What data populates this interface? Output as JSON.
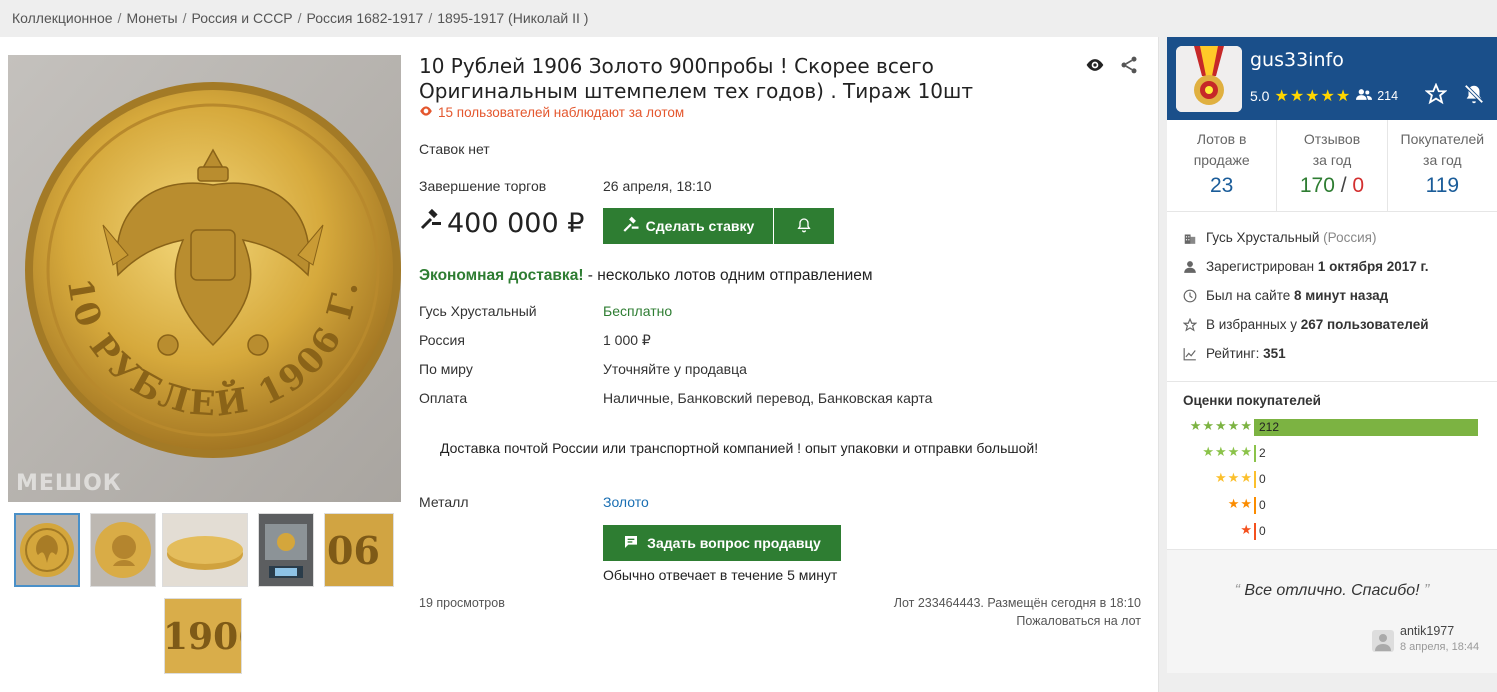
{
  "breadcrumb": [
    "Коллекционное",
    "Монеты",
    "Россия и СССР",
    "Россия 1682-1917",
    "1895-1917 (Николай II )"
  ],
  "lot": {
    "title": "10 Рублей 1906 Золото 900пробы ! Скорее всего Оригинальным штемпелем тех годов) . Тираж 10шт",
    "watchers": "15 пользователей наблюдают за лотом",
    "bids_label": "Ставок нет",
    "end_label": "Завершение торгов",
    "end_value": "26 апреля, 18:10",
    "price": "400 000 ₽",
    "bid_button": "Сделать ставку",
    "eco_bold": "Экономная доставка!",
    "eco_rest": " - несколько лотов одним отправлением",
    "delivery": [
      {
        "label": "Гусь Хрустальный",
        "value": "Бесплатно",
        "green": true
      },
      {
        "label": "Россия",
        "value": "1 000 ₽"
      },
      {
        "label": "По миру",
        "value": "Уточняйте у продавца"
      },
      {
        "label": "Оплата",
        "value": "Наличные, Банковский перевод, Банковская карта"
      }
    ],
    "delivery_note": "Доставка почтой России или транспортной компанией ! опыт упаковки и отправки большой!",
    "metal_label": "Металл",
    "metal_value": "Золото",
    "ask_button": "Задать вопрос продавцу",
    "reply_time": "Обычно отвечает в течение 5 минут",
    "views": "19 просмотров",
    "lot_info": "Лот 233464443. Размещён сегодня в 18:10",
    "complain": "Пожаловаться на лот",
    "watermark": "МЕШОК",
    "coin_denomination": "10 РУБЛЕЙ 1906 Г."
  },
  "seller": {
    "name": "gus33info",
    "rating": "5.0",
    "followers": "214",
    "stats": [
      {
        "label_1": "Лотов в",
        "label_2": "продаже",
        "value": "23"
      },
      {
        "label_1": "Отзывов",
        "label_2": "за год",
        "value_pos": "170",
        "value_sep": " / ",
        "value_neg": "0"
      },
      {
        "label_1": "Покупателей",
        "label_2": "за год",
        "value": "119"
      }
    ],
    "city": "Гусь Хрустальный",
    "country": "(Россия)",
    "registered_label": "Зарегистрирован",
    "registered_value": "1 октября 2017 г.",
    "last_seen_label": "Был на сайте",
    "last_seen_value": "8 минут назад",
    "favorites_label": "В избранных у",
    "favorites_value": "267 пользователей",
    "score_label": "Рейтинг:",
    "score_value": "351",
    "ratings_title": "Оценки покупателей",
    "ratings": [
      {
        "stars": "★★★★★",
        "count": "212",
        "fraction": 1.0,
        "color": "#7cb342"
      },
      {
        "stars": "★★★★",
        "count": "2",
        "fraction": 0.009,
        "color": "#8bc34a"
      },
      {
        "stars": "★★★",
        "count": "0",
        "fraction": 0,
        "color": "#fbc02d"
      },
      {
        "stars": "★★",
        "count": "0",
        "fraction": 0,
        "color": "#fb8c00"
      },
      {
        "stars": "★",
        "count": "0",
        "fraction": 0,
        "color": "#f4511e"
      }
    ],
    "review": {
      "text": "Все отлично. Спасибо!",
      "author": "antik1977",
      "date": "8 апреля, 18:44"
    }
  },
  "colors": {
    "green": "#2e7d32",
    "seller_header": "#1a4f8a",
    "stat_blue": "#1a5c99",
    "warning": "#e4572e"
  }
}
